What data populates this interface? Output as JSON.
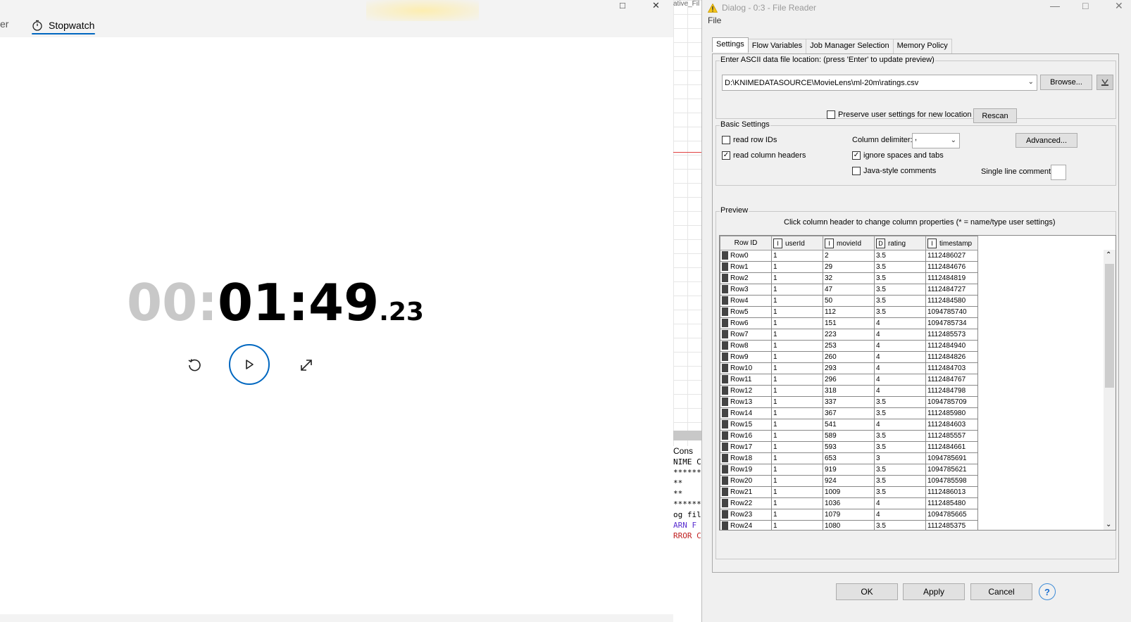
{
  "stopwatch": {
    "prev_tab_label": "er",
    "tab_label": "Stopwatch",
    "time": {
      "hours": "00:",
      "main": "01:49",
      "fraction": ".23"
    },
    "buttons": {
      "reset": "reset-icon",
      "play": "play-icon",
      "expand": "expand-icon"
    },
    "accent": "#0067c0"
  },
  "background": {
    "title_fragment": "ative_Fil",
    "console_label": "Cons",
    "console_lines": [
      "NIME C",
      "*******",
      "**",
      "**",
      "*******",
      "og fil",
      "ARN  F",
      "RROR C"
    ]
  },
  "dialog": {
    "title": "Dialog - 0:3 - File Reader",
    "menu": "File",
    "tabs": [
      "Settings",
      "Flow Variables",
      "Job Manager Selection",
      "Memory Policy"
    ],
    "location": {
      "group_label": "Enter ASCII data file location: (press 'Enter' to update preview)",
      "path": "D:\\KNIMEDATASOURCE\\MovieLens\\ml-20m\\ratings.csv",
      "browse_label": "Browse...",
      "preserve_label": "Preserve user settings for new location",
      "preserve_checked": false,
      "rescan_label": "Rescan"
    },
    "basic": {
      "group_label": "Basic Settings",
      "read_row_ids": "read row IDs",
      "read_row_ids_checked": false,
      "read_col_headers": "read column headers",
      "read_col_headers_checked": true,
      "col_delim_label": "Column delimiter:",
      "col_delim_value": ",",
      "ignore_spaces": "ignore spaces and tabs",
      "ignore_spaces_checked": true,
      "java_comments": "Java-style comments",
      "java_comments_checked": false,
      "single_line_label": "Single line comment:",
      "advanced_label": "Advanced..."
    },
    "preview": {
      "group_label": "Preview",
      "hint": "Click column header to change column properties (* = name/type user settings)",
      "columns": [
        {
          "name": "Row ID",
          "type": ""
        },
        {
          "name": "userId",
          "type": "I"
        },
        {
          "name": "movieId",
          "type": "I"
        },
        {
          "name": "rating",
          "type": "D"
        },
        {
          "name": "timestamp",
          "type": "I"
        }
      ],
      "rows": [
        [
          "Row0",
          "1",
          "2",
          "3.5",
          "1112486027"
        ],
        [
          "Row1",
          "1",
          "29",
          "3.5",
          "1112484676"
        ],
        [
          "Row2",
          "1",
          "32",
          "3.5",
          "1112484819"
        ],
        [
          "Row3",
          "1",
          "47",
          "3.5",
          "1112484727"
        ],
        [
          "Row4",
          "1",
          "50",
          "3.5",
          "1112484580"
        ],
        [
          "Row5",
          "1",
          "112",
          "3.5",
          "1094785740"
        ],
        [
          "Row6",
          "1",
          "151",
          "4",
          "1094785734"
        ],
        [
          "Row7",
          "1",
          "223",
          "4",
          "1112485573"
        ],
        [
          "Row8",
          "1",
          "253",
          "4",
          "1112484940"
        ],
        [
          "Row9",
          "1",
          "260",
          "4",
          "1112484826"
        ],
        [
          "Row10",
          "1",
          "293",
          "4",
          "1112484703"
        ],
        [
          "Row11",
          "1",
          "296",
          "4",
          "1112484767"
        ],
        [
          "Row12",
          "1",
          "318",
          "4",
          "1112484798"
        ],
        [
          "Row13",
          "1",
          "337",
          "3.5",
          "1094785709"
        ],
        [
          "Row14",
          "1",
          "367",
          "3.5",
          "1112485980"
        ],
        [
          "Row15",
          "1",
          "541",
          "4",
          "1112484603"
        ],
        [
          "Row16",
          "1",
          "589",
          "3.5",
          "1112485557"
        ],
        [
          "Row17",
          "1",
          "593",
          "3.5",
          "1112484661"
        ],
        [
          "Row18",
          "1",
          "653",
          "3",
          "1094785691"
        ],
        [
          "Row19",
          "1",
          "919",
          "3.5",
          "1094785621"
        ],
        [
          "Row20",
          "1",
          "924",
          "3.5",
          "1094785598"
        ],
        [
          "Row21",
          "1",
          "1009",
          "3.5",
          "1112486013"
        ],
        [
          "Row22",
          "1",
          "1036",
          "4",
          "1112485480"
        ],
        [
          "Row23",
          "1",
          "1079",
          "4",
          "1094785665"
        ],
        [
          "Row24",
          "1",
          "1080",
          "3.5",
          "1112485375"
        ]
      ]
    },
    "footer": {
      "ok": "OK",
      "apply": "Apply",
      "cancel": "Cancel",
      "help": "?"
    }
  }
}
